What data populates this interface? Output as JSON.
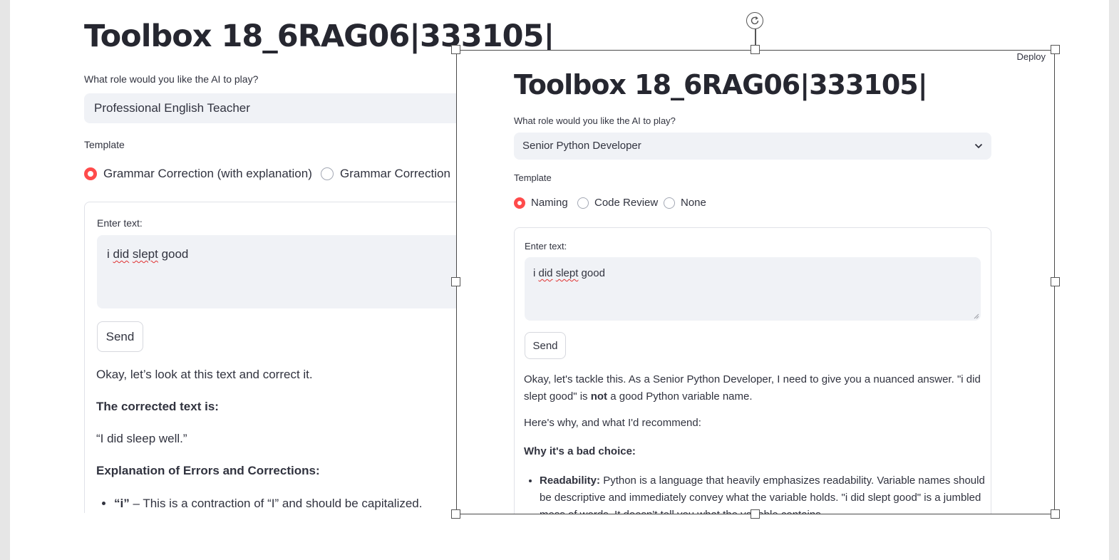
{
  "background_app": {
    "title": "Toolbox 18_6RAG06|333105|",
    "role_label": "What role would you like the AI to play?",
    "role_value": "Professional English Teacher",
    "template_label": "Template",
    "template_options": [
      "Grammar Correction (with explanation)",
      "Grammar Correction"
    ],
    "selected_template": "Grammar Correction (with explanation)",
    "input_label": "Enter text:",
    "input_value_parts": [
      "i ",
      "did",
      " ",
      "slept",
      " good"
    ],
    "send_label": "Send",
    "response": {
      "intro": "Okay, let’s look at this text and correct it.",
      "corrected_heading": "The corrected text is:",
      "corrected_text": "“I did sleep well.”",
      "explanation_heading": "Explanation of Errors and Corrections:",
      "bullet_1_bold": "“i”",
      "bullet_1_text": " – This is a contraction of “I” and should be capitalized."
    }
  },
  "overlay_app": {
    "deploy_label": "Deploy",
    "title": "Toolbox 18_6RAG06|333105|",
    "role_label": "What role would you like the AI to play?",
    "role_value": "Senior Python Developer",
    "template_label": "Template",
    "template_options": [
      "Naming",
      "Code Review",
      "None"
    ],
    "selected_template": "Naming",
    "input_label": "Enter text:",
    "input_value_parts": [
      "i ",
      "did",
      " ",
      "slept",
      " good"
    ],
    "send_label": "Send",
    "response": {
      "para1_a": "Okay, let's tackle this. As a Senior Python Developer, I need to give you a nuanced answer. \"i did slept good\" is ",
      "para1_bold": "not",
      "para1_b": " a good Python variable name.",
      "para2": "Here's why, and what I'd recommend:",
      "heading": "Why it's a bad choice:",
      "bullet_1_bold": "Readability:",
      "bullet_1_text": " Python is a language that heavily emphasizes readability. Variable names should be descriptive and immediately convey what the variable holds. \"i did slept good\" is a jumbled mess of words. It doesn't tell you what the variable contains."
    }
  }
}
